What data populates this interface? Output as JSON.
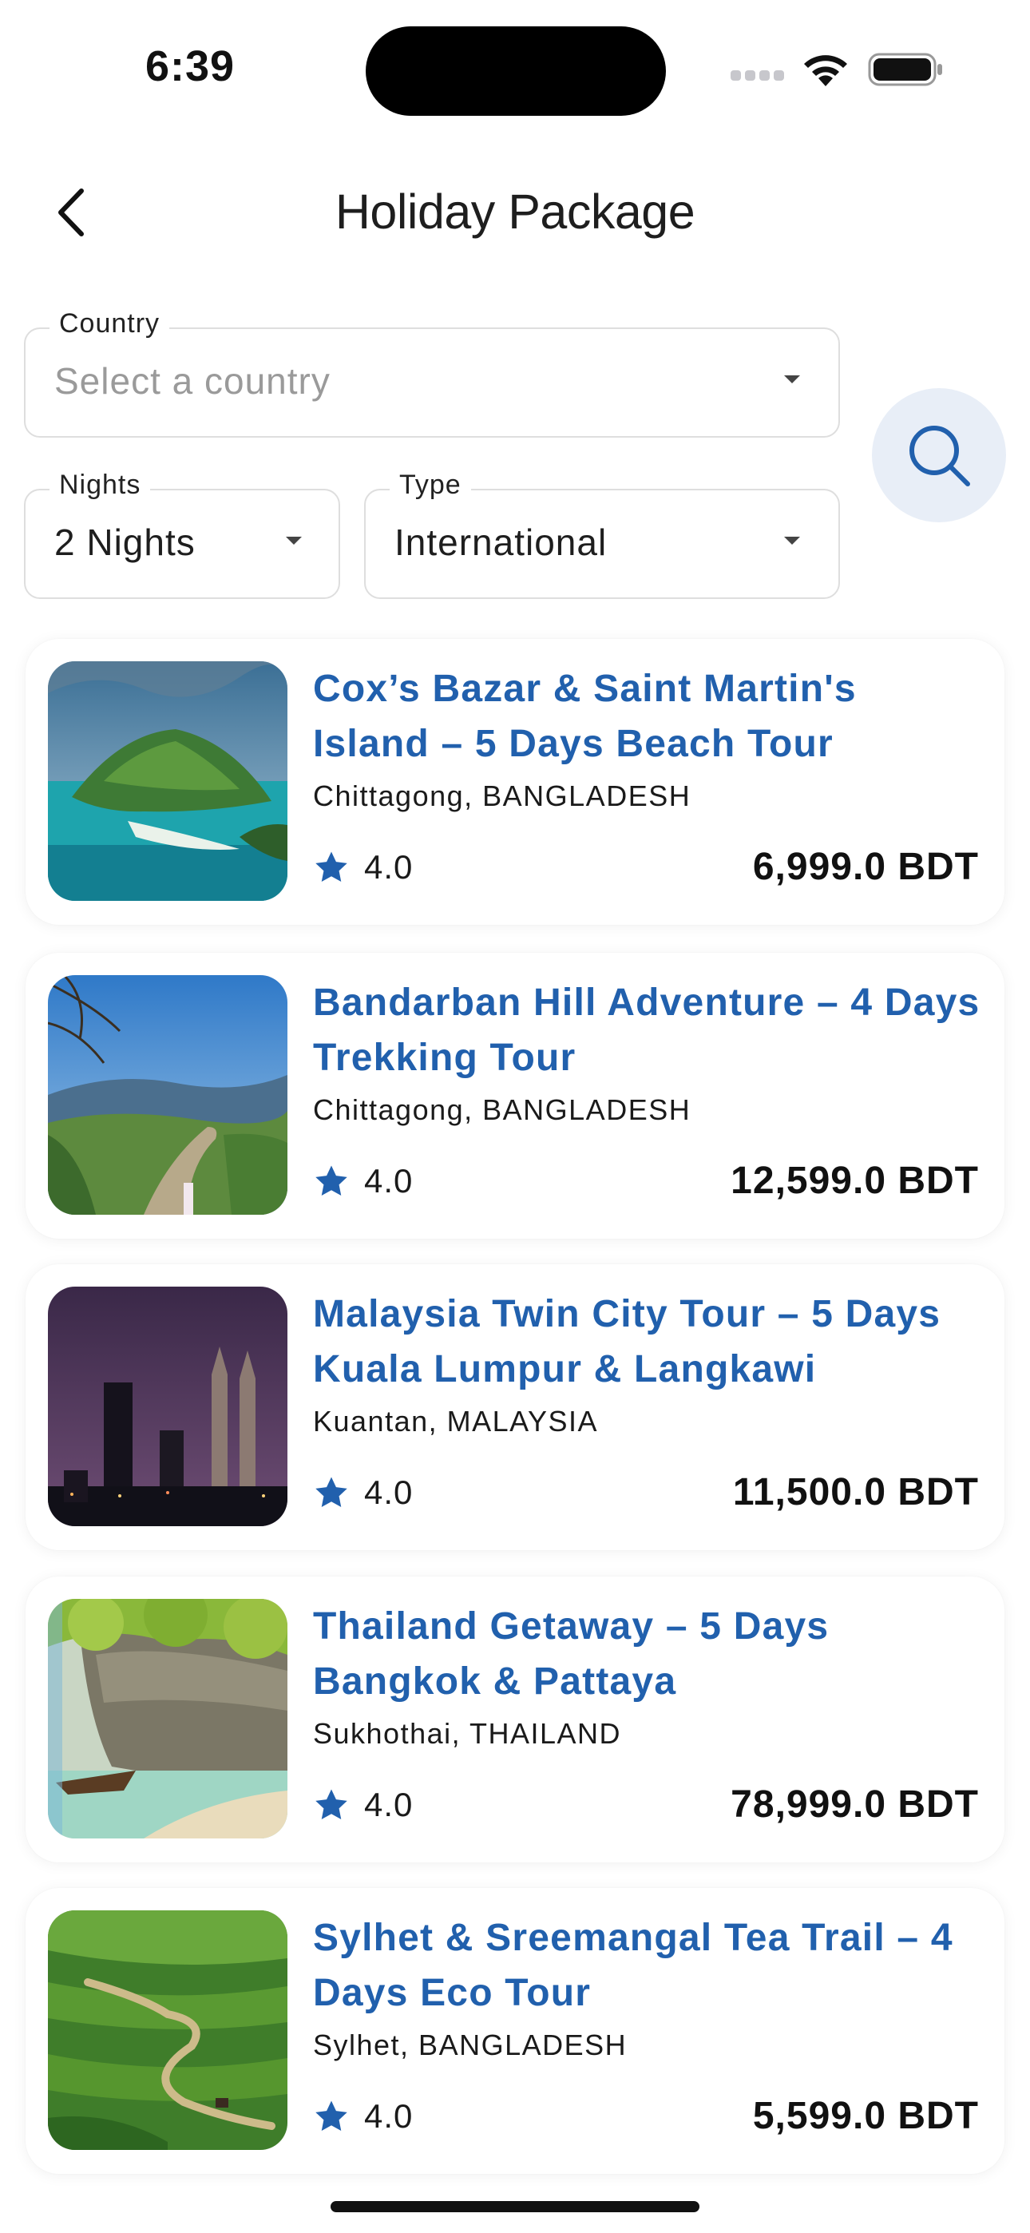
{
  "status_bar": {
    "time": "6:39"
  },
  "header": {
    "title": "Holiday Package"
  },
  "filters": {
    "country": {
      "label": "Country",
      "placeholder": "Select a country"
    },
    "nights": {
      "label": "Nights",
      "value": "2 Nights"
    },
    "type": {
      "label": "Type",
      "value": "International"
    }
  },
  "packages": [
    {
      "title": "Cox’s Bazar & Saint Martin's Island – 5 Days Beach Tour",
      "location": "Chittagong, BANGLADESH",
      "rating": "4.0",
      "price": "6,999.0 BDT"
    },
    {
      "title": "Bandarban Hill Adventure – 4 Days Trekking Tour",
      "location": "Chittagong, BANGLADESH",
      "rating": "4.0",
      "price": "12,599.0 BDT"
    },
    {
      "title": "Malaysia Twin City Tour – 5 Days Kuala Lumpur & Langkawi",
      "location": "Kuantan, MALAYSIA",
      "rating": "4.0",
      "price": "11,500.0 BDT"
    },
    {
      "title": "Thailand Getaway – 5 Days Bangkok & Pattaya",
      "location": "Sukhothai, THAILAND",
      "rating": "4.0",
      "price": "78,999.0 BDT"
    },
    {
      "title": "Sylhet & Sreemangal Tea Trail – 4 Days Eco Tour",
      "location": "Sylhet, BANGLADESH",
      "rating": "4.0",
      "price": "5,599.0 BDT"
    }
  ],
  "colors": {
    "accent": "#2160ad",
    "search_bg": "#e8eef7",
    "star": "#2160ad"
  }
}
